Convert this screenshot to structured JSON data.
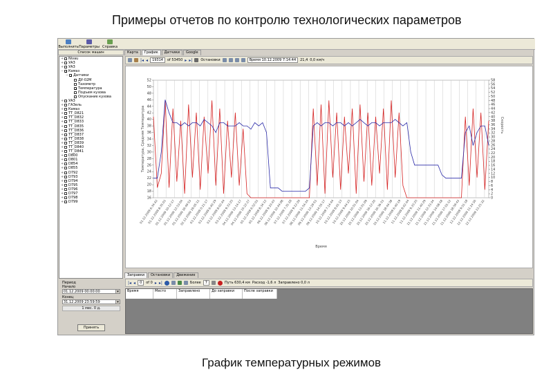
{
  "slide": {
    "title": "Примеры отчетов по контролю технологических параметров",
    "caption": "График температурных режимов"
  },
  "menubar": [
    {
      "label": "Выполнить",
      "icon": "run-icon"
    },
    {
      "label": "Параметры",
      "icon": "settings-icon"
    },
    {
      "label": "Справка",
      "icon": "help-icon"
    }
  ],
  "tree": {
    "header": "Список машин",
    "items": [
      {
        "label": "Nivau",
        "level": 0,
        "expander": "+",
        "checked": false
      },
      {
        "label": "УАЗ",
        "level": 0,
        "expander": "+",
        "checked": false
      },
      {
        "label": "УАЗ",
        "level": 0,
        "expander": "+",
        "checked": false
      },
      {
        "label": "Камаз",
        "level": 0,
        "expander": "−",
        "checked": true
      },
      {
        "label": "Датчики",
        "level": 1,
        "expander": "−",
        "checked": true
      },
      {
        "label": "ДУ-02М",
        "level": 2,
        "expander": "",
        "checked": false
      },
      {
        "label": "Тахометр",
        "level": 2,
        "expander": "",
        "checked": false
      },
      {
        "label": "Температура",
        "level": 2,
        "expander": "",
        "checked": true
      },
      {
        "label": "Подъем кузова",
        "level": 2,
        "expander": "",
        "checked": false
      },
      {
        "label": "Опускание кузова",
        "level": 2,
        "expander": "",
        "checked": false
      },
      {
        "label": "УАЗ",
        "level": 0,
        "expander": "+",
        "checked": false
      },
      {
        "label": "ГАЗель",
        "level": 0,
        "expander": "+",
        "checked": false
      },
      {
        "label": "Камаз",
        "level": 0,
        "expander": "+",
        "checked": false
      },
      {
        "label": "ТТ_D821",
        "level": 0,
        "expander": "+",
        "checked": false
      },
      {
        "label": "ТТ_D832",
        "level": 0,
        "expander": "+",
        "checked": false
      },
      {
        "label": "ТТ_D833",
        "level": 0,
        "expander": "+",
        "checked": false
      },
      {
        "label": "ТТ_D835",
        "level": 0,
        "expander": "+",
        "checked": false
      },
      {
        "label": "ТТ_D836",
        "level": 0,
        "expander": "+",
        "checked": false
      },
      {
        "label": "ТТ_D837",
        "level": 0,
        "expander": "+",
        "checked": false
      },
      {
        "label": "ТТ_D838",
        "level": 0,
        "expander": "+",
        "checked": false
      },
      {
        "label": "ТТ_D839",
        "level": 0,
        "expander": "+",
        "checked": false
      },
      {
        "label": "ТТ_D840",
        "level": 0,
        "expander": "+",
        "checked": false
      },
      {
        "label": "ТТ_D841",
        "level": 0,
        "expander": "+",
        "checked": false
      },
      {
        "label": "D800",
        "level": 0,
        "expander": "+",
        "checked": false
      },
      {
        "label": "D801",
        "level": 0,
        "expander": "+",
        "checked": false
      },
      {
        "label": "D854",
        "level": 0,
        "expander": "+",
        "checked": false
      },
      {
        "label": "D855",
        "level": 0,
        "expander": "+",
        "checked": false
      },
      {
        "label": "D792",
        "level": 0,
        "expander": "+",
        "checked": false
      },
      {
        "label": "D793",
        "level": 0,
        "expander": "+",
        "checked": false
      },
      {
        "label": "D794",
        "level": 0,
        "expander": "+",
        "checked": false
      },
      {
        "label": "D795",
        "level": 0,
        "expander": "+",
        "checked": false
      },
      {
        "label": "D796",
        "level": 0,
        "expander": "+",
        "checked": false
      },
      {
        "label": "D797",
        "level": 0,
        "expander": "+",
        "checked": false
      },
      {
        "label": "D798",
        "level": 0,
        "expander": "+",
        "checked": false
      },
      {
        "label": "D799",
        "level": 0,
        "expander": "+",
        "checked": false
      }
    ]
  },
  "period": {
    "label": "Период",
    "from_label": "Начало",
    "from_value": "01.12.2009 00:00:00",
    "to_label": "Конец",
    "to_value": "31.12.2009 23:59:59",
    "interval": "1 мес. 0 д.",
    "apply_label": "Принять"
  },
  "tabs": [
    {
      "label": "Карта",
      "active": false
    },
    {
      "label": "График",
      "active": true
    },
    {
      "label": "Датчики",
      "active": false
    },
    {
      "label": "Google",
      "active": false
    }
  ],
  "toolbar": {
    "record": "19314",
    "of_total": "of 53450",
    "stops_label": "Остановки",
    "time_label": "Время 10.12.2009 7:14:44",
    "value": "21,4",
    "speed": "0,0 км/ч"
  },
  "chart_data": {
    "type": "line",
    "xlabel": "Время",
    "ylabel": "Температура, Средняя Температура",
    "y2label": "Скорость",
    "ylim": [
      16,
      52
    ],
    "y2lim": [
      0,
      58
    ],
    "y_ticks": [
      "52",
      "50",
      "48",
      "46",
      "44",
      "42",
      "40",
      "38",
      "36",
      "34",
      "32",
      "30",
      "28",
      "26",
      "24",
      "22",
      "20",
      "18",
      "16"
    ],
    "y2_ticks": [
      "58",
      "56",
      "54",
      "52",
      "50",
      "48",
      "46",
      "44",
      "42",
      "40",
      "38",
      "36",
      "34",
      "32",
      "30",
      "28",
      "26",
      "24",
      "22",
      "20",
      "18",
      "16",
      "14",
      "12",
      "10",
      "8",
      "6",
      "4",
      "2",
      "0"
    ],
    "x_ticks": [
      "01.12.2009 6:34:42",
      "01.12.2009 8:35:01",
      "01.12.2009 10:12:17",
      "01.12.2009 12:53:04",
      "01.12.2009 16:49:53",
      "02.12.2009 19:05:11",
      "03.12.2009 0:11:17",
      "03.12.2009 6:40:19",
      "03.12.2009 8:02:44",
      "03.12.2009 9:33:25",
      "04.12.2009 13:14:17",
      "04.12.2009 15:22:27",
      "05.12.2009 6:52:01",
      "05.12.2009 8:34:12",
      "06.12.2009 9:10:43",
      "06.12.2009 10:44:08",
      "07.12.2009 7:31:18",
      "07.12.2009 9:12:26",
      "08.12.2009 11:54:34",
      "09.12.2009 13:29:51",
      "09.12.2009 14:55:17",
      "10.12.2009 7:14:44",
      "10.12.2009 8:01:13",
      "10.12.2009 9:44:15",
      "10.12.2009 10:51:04",
      "10.12.2009 13:51:09",
      "10.12.2009 16:12:20",
      "10.12.2009 16:36:33",
      "10.12.2009 18:44:38",
      "11.12.2009 6:40:19",
      "11.12.2009 8:02:44",
      "11.12.2009 9:33:25",
      "11.12.2009 11:40:29",
      "11.12.2009 12:33:34",
      "11.12.2009 14:08:18",
      "11.12.2009 17:01:12",
      "11.12.2009 18:59:43",
      "12.12.2009 9:51:18",
      "12.12.2009 11:14:16",
      "12.12.2009 13:21:32"
    ],
    "series": [
      {
        "name": "Температура",
        "color": "#2a2aa8",
        "values": [
          22,
          22,
          30,
          46,
          42,
          39,
          39,
          38,
          39,
          38,
          39,
          39,
          38,
          40,
          39,
          38,
          36,
          39,
          39,
          38,
          38,
          38,
          39,
          38,
          38,
          37,
          39,
          38,
          39,
          36,
          19,
          19,
          19,
          18,
          18,
          18,
          18,
          18,
          18,
          18,
          19,
          38,
          39,
          38,
          39,
          39,
          38,
          39,
          39,
          38,
          39,
          38,
          39,
          40,
          39,
          38,
          39,
          39,
          38,
          39,
          39,
          39,
          40,
          39,
          38,
          39,
          30,
          26,
          26,
          26,
          26,
          26,
          26,
          26,
          23,
          22,
          22,
          22,
          22,
          22,
          36,
          38,
          32,
          36,
          38,
          38,
          32
        ]
      },
      {
        "name": "Скорость",
        "color": "#d42020",
        "values": [
          40,
          5,
          12,
          48,
          5,
          44,
          8,
          38,
          2,
          46,
          10,
          42,
          4,
          40,
          12,
          48,
          6,
          44,
          2,
          38,
          10,
          42,
          6,
          34,
          2,
          0,
          0,
          0,
          0,
          0,
          0,
          0,
          0,
          0,
          0,
          0,
          0,
          0,
          0,
          0,
          0,
          44,
          6,
          46,
          2,
          48,
          10,
          42,
          4,
          40,
          12,
          44,
          2,
          46,
          8,
          42,
          6,
          40,
          12,
          44,
          4,
          48,
          10,
          42,
          6,
          0,
          0,
          0,
          0,
          0,
          0,
          0,
          0,
          0,
          0,
          0,
          0,
          0,
          0,
          0,
          40,
          6,
          44,
          10,
          42,
          4,
          38
        ]
      }
    ],
    "grid": true,
    "colors": {
      "temperature": "#2a2aa8",
      "speed": "#d42020"
    }
  },
  "bottom_tabs": [
    {
      "label": "Заправки",
      "active": true
    },
    {
      "label": "Остановки",
      "active": false
    },
    {
      "label": "Движение",
      "active": false
    }
  ],
  "bottom_toolbar": {
    "record": "0",
    "of_total": "of 0",
    "more_label": "Более",
    "more_value": "7",
    "path_label": "Путь 630,4 км",
    "consumption_label": "Расход -1,6 л",
    "refueled_label": "Заправлено 0,0 л"
  },
  "table": {
    "columns": [
      "Время",
      "Место",
      "Заправлено",
      "До заправки",
      "После заправки"
    ],
    "rows": []
  }
}
